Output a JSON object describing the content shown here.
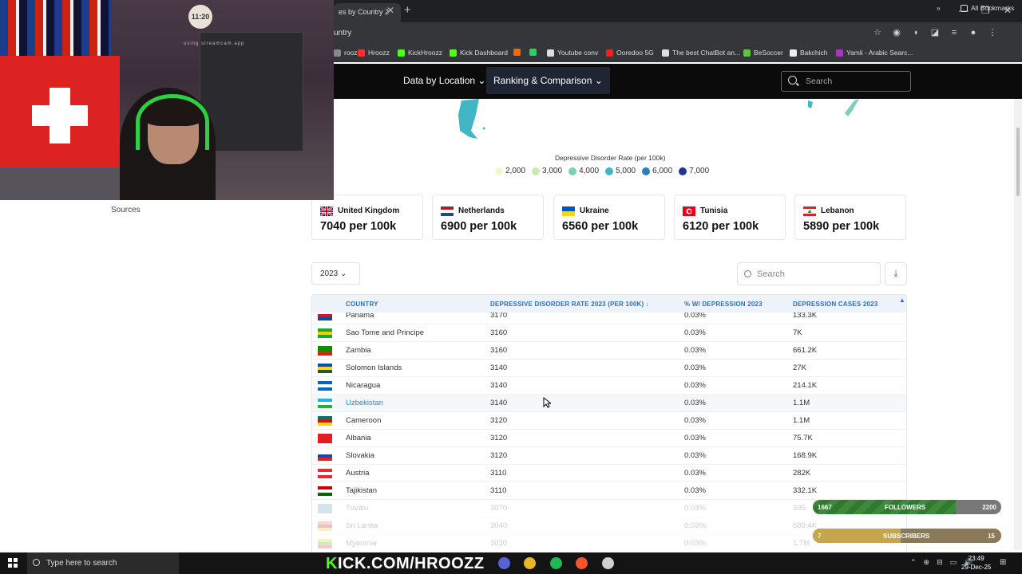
{
  "browser": {
    "tab_title": "es by Country 2",
    "tab_close": "✕",
    "new_tab": "+",
    "url": "untry",
    "window_controls": [
      "—",
      "❐",
      "✕"
    ],
    "bookmarks": [
      {
        "label": "roozz",
        "color": "#888"
      },
      {
        "label": "Hroozz",
        "color": "#e33"
      },
      {
        "label": "KickHroozz",
        "color": "#53fc18"
      },
      {
        "label": "Kick Dashboard",
        "color": "#53fc18"
      },
      {
        "label": "",
        "color": "#f60"
      },
      {
        "label": "",
        "color": "#25d366"
      },
      {
        "label": "Youtube conv",
        "color": "#ddd"
      },
      {
        "label": "Ooredoo 5G",
        "color": "#e22"
      },
      {
        "label": "The best ChatBot an...",
        "color": "#ddd"
      },
      {
        "label": "BeSoccer",
        "color": "#5c3"
      },
      {
        "label": "Bakchich",
        "color": "#eee"
      },
      {
        "label": "Yamli - Arabic Searc...",
        "color": "#a3c"
      }
    ],
    "more_bookmarks": "»",
    "all_bookmarks": "All Bookmarks"
  },
  "site": {
    "nav": [
      {
        "label": "Data by Location ⌄"
      },
      {
        "label": "Ranking & Comparison ⌄"
      }
    ],
    "search_placeholder": "Search"
  },
  "legend": {
    "title": "Depressive Disorder Rate (per 100k)",
    "items": [
      {
        "label": "2,000",
        "color": "#f4f7c9"
      },
      {
        "label": "3,000",
        "color": "#c7e9b4"
      },
      {
        "label": "4,000",
        "color": "#7fcdbb"
      },
      {
        "label": "5,000",
        "color": "#41b6c4"
      },
      {
        "label": "6,000",
        "color": "#2c7fb8"
      },
      {
        "label": "7,000",
        "color": "#253494"
      }
    ]
  },
  "sidebar": {
    "sources": "Sources"
  },
  "top_cards": [
    {
      "country": "United Kingdom",
      "value": "7040 per 100k",
      "flag": "gb"
    },
    {
      "country": "Netherlands",
      "value": "6900 per 100k",
      "flag": "nl"
    },
    {
      "country": "Ukraine",
      "value": "6560 per 100k",
      "flag": "ua"
    },
    {
      "country": "Tunisia",
      "value": "6120 per 100k",
      "flag": "tn"
    },
    {
      "country": "Lebanon",
      "value": "5890 per 100k",
      "flag": "lb"
    }
  ],
  "controls": {
    "year": "2023",
    "year_caret": "⌄",
    "search_placeholder": "Search",
    "download": "⤓"
  },
  "table": {
    "headers": [
      "COUNTRY",
      "DEPRESSIVE DISORDER RATE 2023 (PER 100K) ↓",
      "% W/ DEPRESSION 2023",
      "DEPRESSION CASES 2023"
    ],
    "scroll_up": "▲",
    "rows": [
      {
        "country": "Panama",
        "rate": "3170",
        "pct": "0.03%",
        "cases": "133.3K",
        "flag": [
          "#fff",
          "#d21034",
          "#005293"
        ]
      },
      {
        "country": "Sao Tome and Principe",
        "rate": "3160",
        "pct": "0.03%",
        "cases": "7K",
        "flag": [
          "#12ad2b",
          "#ffce00",
          "#12ad2b"
        ]
      },
      {
        "country": "Zambia",
        "rate": "3160",
        "pct": "0.03%",
        "cases": "661.2K",
        "flag": [
          "#198a00",
          "#198a00",
          "#de2010"
        ]
      },
      {
        "country": "Solomon Islands",
        "rate": "3140",
        "pct": "0.03%",
        "cases": "27K",
        "flag": [
          "#0051ba",
          "#fcd116",
          "#215b33"
        ]
      },
      {
        "country": "Nicaragua",
        "rate": "3140",
        "pct": "0.03%",
        "cases": "214.1K",
        "flag": [
          "#0067c6",
          "#ffffff",
          "#0067c6"
        ]
      },
      {
        "country": "Uzbekistan",
        "rate": "3140",
        "pct": "0.03%",
        "cases": "1.1M",
        "flag": [
          "#1eb5e5",
          "#ffffff",
          "#1eb53a"
        ],
        "highlight": true
      },
      {
        "country": "Cameroon",
        "rate": "3120",
        "pct": "0.03%",
        "cases": "1.1M",
        "flag": [
          "#007a5e",
          "#ce1126",
          "#fcd116"
        ]
      },
      {
        "country": "Albania",
        "rate": "3120",
        "pct": "0.03%",
        "cases": "75.7K",
        "flag": [
          "#e41e20",
          "#e41e20",
          "#e41e20"
        ]
      },
      {
        "country": "Slovakia",
        "rate": "3120",
        "pct": "0.03%",
        "cases": "168.9K",
        "flag": [
          "#ffffff",
          "#0b4ea2",
          "#ee1c25"
        ]
      },
      {
        "country": "Austria",
        "rate": "3110",
        "pct": "0.03%",
        "cases": "282K",
        "flag": [
          "#ed2939",
          "#ffffff",
          "#ed2939"
        ]
      },
      {
        "country": "Tajikistan",
        "rate": "3110",
        "pct": "0.03%",
        "cases": "332.1K",
        "flag": [
          "#cc0000",
          "#ffffff",
          "#006600"
        ]
      },
      {
        "country": "Tuvalu",
        "rate": "3070",
        "pct": "0.03%",
        "cases": "335",
        "flag": [
          "#5b97b1",
          "#5b97b1",
          "#5b97b1"
        ],
        "faded": true
      },
      {
        "country": "Sri Lanka",
        "rate": "3040",
        "pct": "0.03%",
        "cases": "689.4K",
        "flag": [
          "#ff7300",
          "#8d153a",
          "#ffbe29"
        ],
        "faded": true
      },
      {
        "country": "Myanmar",
        "rate": "3030",
        "pct": "0.03%",
        "cases": "1.7M",
        "flag": [
          "#fecb00",
          "#34b233",
          "#ea2839"
        ],
        "faded": true
      }
    ]
  },
  "webcam": {
    "clock": "11:20",
    "watermark": "using streamcam.app"
  },
  "overlays": {
    "followers": {
      "current": "1667",
      "label": "FOLLOWERS",
      "goal": "2200",
      "progress": 0.758
    },
    "subscribers": {
      "current": "7",
      "label": "SUBSCRIBERS",
      "goal": "15",
      "progress": 0.467
    }
  },
  "taskbar": {
    "search_placeholder": "Type here to search",
    "kick_prefix": "K",
    "kick_rest": "ICK.COM/HROOZZ",
    "tray": [
      "⌃",
      "⊕",
      "⊟",
      "▭",
      "🔊",
      "⊞"
    ],
    "time": "23:49",
    "date": "29-Dec-25",
    "app_icons": [
      {
        "name": "chrome-icon",
        "color": "#e9b52d"
      },
      {
        "name": "spotify-icon",
        "color": "#1db954"
      },
      {
        "name": "brave-icon",
        "color": "#fb542b"
      },
      {
        "name": "obs-icon",
        "color": "#cfcfcf"
      }
    ]
  }
}
